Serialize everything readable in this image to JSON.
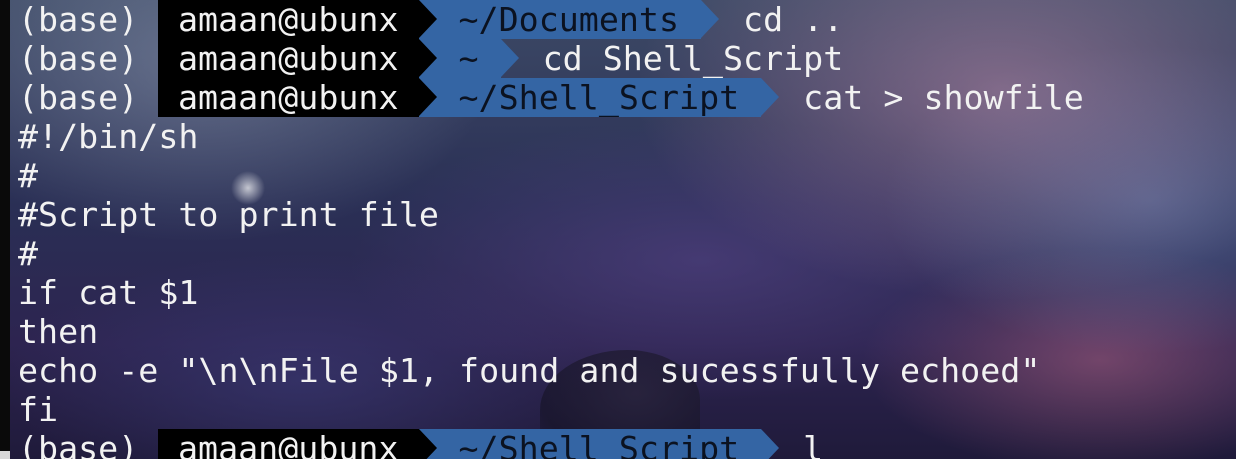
{
  "prompt": {
    "env": "(base)",
    "user_host": "amaan@ubunx"
  },
  "commands": [
    {
      "dir": "~/Documents",
      "cmd": "cd .."
    },
    {
      "dir": "~",
      "cmd": "cd Shell_Script"
    },
    {
      "dir": "~/Shell_Script",
      "cmd": "cat > showfile"
    }
  ],
  "output_lines": [
    "#!/bin/sh",
    "#",
    "#Script to print file",
    "#",
    "if cat $1",
    "then",
    "echo -e \"\\n\\nFile $1, found and sucessfully echoed\"",
    "fi"
  ],
  "current_prompt": {
    "dir": "~/Shell_Script",
    "input": "l"
  },
  "colors": {
    "dir_segment": "#3465a4",
    "user_segment": "#000000",
    "text": "#f2f2f2",
    "dir_text": "#0b1220"
  }
}
